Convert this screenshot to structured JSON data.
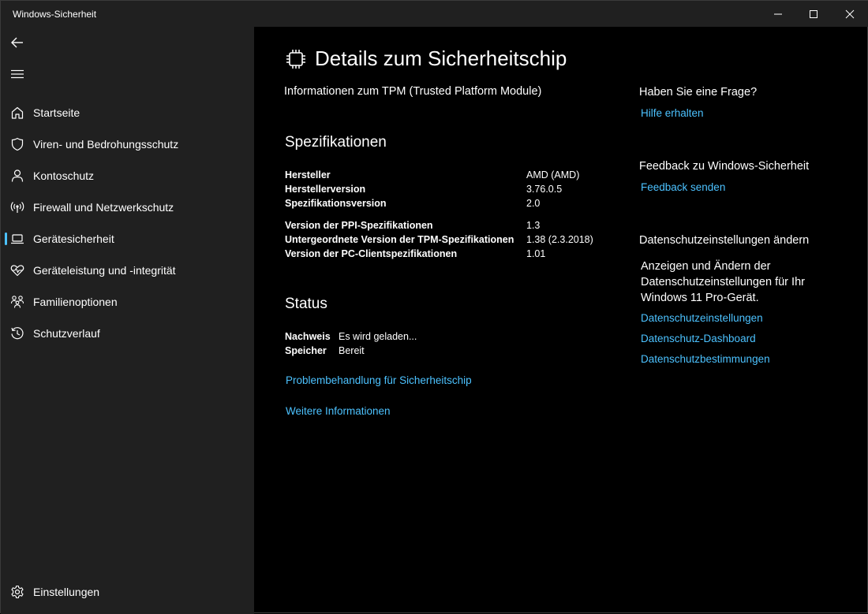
{
  "window": {
    "title": "Windows-Sicherheit"
  },
  "sidebar": {
    "items": [
      {
        "label": "Startseite",
        "icon": "home-icon"
      },
      {
        "label": "Viren- und Bedrohungsschutz",
        "icon": "shield-icon"
      },
      {
        "label": "Kontoschutz",
        "icon": "person-icon"
      },
      {
        "label": "Firewall und Netzwerkschutz",
        "icon": "antenna-icon"
      },
      {
        "label": "Gerätesicherheit",
        "icon": "laptop-icon",
        "active": true
      },
      {
        "label": "Geräteleistung und -integrität",
        "icon": "heart-pulse-icon"
      },
      {
        "label": "Familienoptionen",
        "icon": "family-icon"
      },
      {
        "label": "Schutzverlauf",
        "icon": "history-icon"
      }
    ],
    "settings_label": "Einstellungen"
  },
  "main": {
    "title": "Details zum Sicherheitschip",
    "subtitle": "Informationen zum TPM (Trusted Platform Module)",
    "specs": {
      "heading": "Spezifikationen",
      "rows": [
        {
          "label": "Hersteller",
          "value": "AMD (AMD)"
        },
        {
          "label": "Herstellerversion",
          "value": "3.76.0.5"
        },
        {
          "label": "Spezifikationsversion",
          "value": "2.0"
        },
        {
          "label": "Version der PPI-Spezifikationen",
          "value": "1.3"
        },
        {
          "label": "Untergeordnete Version der TPM-Spezifikationen",
          "value": "1.38 (2.3.2018)"
        },
        {
          "label": "Version der PC-Clientspezifikationen",
          "value": "1.01"
        }
      ]
    },
    "status": {
      "heading": "Status",
      "rows": [
        {
          "label": "Nachweis",
          "value": "Es wird geladen..."
        },
        {
          "label": "Speicher",
          "value": "Bereit"
        }
      ]
    },
    "links": {
      "troubleshoot": "Problembehandlung für Sicherheitschip",
      "more_info": "Weitere Informationen"
    }
  },
  "right_panel": {
    "question_heading": "Haben Sie eine Frage?",
    "help_link": "Hilfe erhalten",
    "feedback_heading": "Feedback zu Windows-Sicherheit",
    "feedback_link": "Feedback senden",
    "privacy_heading": "Datenschutzeinstellungen ändern",
    "privacy_text": "Anzeigen und Ändern der Datenschutzeinstellungen für Ihr Windows 11 Pro-Gerät.",
    "privacy_links": [
      "Datenschutzeinstellungen",
      "Datenschutz-Dashboard",
      "Datenschutzbestimmungen"
    ]
  },
  "colors": {
    "accent": "#4cc2ff",
    "sidebar_bg": "#202020",
    "content_bg": "#000000"
  }
}
